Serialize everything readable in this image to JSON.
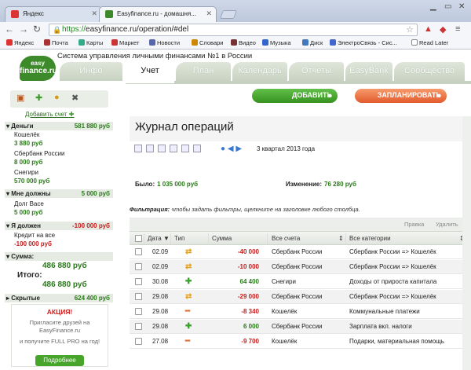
{
  "browser": {
    "tabs": [
      {
        "title": "Яндекс",
        "favicon_color": "#d33"
      },
      {
        "title": "Easyfinance.ru - домашня...",
        "favicon_color": "#3d8a2a"
      }
    ],
    "url_https": "https://",
    "url_rest": "easyfinance.ru/operation/#del",
    "bookmarks": [
      "Яндекс",
      "Почта",
      "Карты",
      "Маркет",
      "Новости",
      "Словари",
      "Видео",
      "Музыка",
      "Диск",
      "ЭлектроСвязь - Сис...",
      "Read Later"
    ],
    "bookmark_colors": [
      "#d33",
      "#a33",
      "#3a8",
      "#c33",
      "#56a",
      "#c80",
      "#733",
      "#36c",
      "#47b",
      "#46c",
      "#fff"
    ]
  },
  "site": {
    "logo_top": "easy",
    "logo_bottom": "finance.ru",
    "slogan": "Система управления личными финансами №1 в России",
    "nav_tabs": [
      "Инфо",
      "Учет",
      "План",
      "Календарь",
      "Отчеты",
      "EasyBank",
      "Сообщество"
    ]
  },
  "sidebar": {
    "add_account": "Добавить счет",
    "sections": [
      {
        "title": "Деньги",
        "amount": "581 880 руб",
        "negative": false,
        "items": [
          {
            "name": "Кошелёк",
            "value": "3 880 руб"
          },
          {
            "name": "Сбербанк России",
            "value": "8 000 руб"
          },
          {
            "name": "Снегири",
            "value": "570 000 руб"
          }
        ]
      },
      {
        "title": "Мне должны",
        "amount": "5 000 руб",
        "negative": false,
        "items": [
          {
            "name": "Долг Васе",
            "value": "5 000 руб"
          }
        ]
      },
      {
        "title": "Я должен",
        "amount": "-100 000 руб",
        "negative": true,
        "items": [
          {
            "name": "Кредит на все",
            "value": "-100 000 руб"
          }
        ]
      }
    ],
    "sum_title": "Сумма:",
    "sum_value": "486 880 руб",
    "total_label": "Итого:",
    "total_value": "486 880 руб",
    "hidden_title": "Скрытые",
    "hidden_amount": "624 400 руб",
    "promo_title": "АКЦИЯ!",
    "promo_text_1": "Пригласите друзей на EasyFinance.ru",
    "promo_text_2": "и получите FULL PRO на год!",
    "promo_button": "Подробнее"
  },
  "main": {
    "add_button": "ДОБАВИТЬ",
    "plan_button": "ЗАПЛАНИРОВАТЬ",
    "page_title": "Журнал операций",
    "period": "3 квартал 2013 года",
    "was_label": "Было:",
    "was_value": "1 035 000 руб",
    "change_label": "Изменение:",
    "change_value": "76 280 руб",
    "filter_label": "Фильтрация:",
    "filter_text": "чтобы задать фильтры, щелкните на заголовке любого столбца.",
    "grid_links": [
      "Правка",
      "Удалить"
    ],
    "columns": [
      "Дата",
      "Тип",
      "Сумма",
      "Все счета",
      "Все категории"
    ],
    "rows": [
      {
        "date": "02.09",
        "type": "transfer",
        "amount": "-40 000",
        "account": "Сбербанк России",
        "category": "Сбербанк России => Кошелёк"
      },
      {
        "date": "02.09",
        "type": "transfer",
        "amount": "-10 000",
        "account": "Сбербанк России",
        "category": "Сбербанк России => Кошелёк"
      },
      {
        "date": "30.08",
        "type": "income",
        "amount": "64 400",
        "account": "Снегири",
        "category": "Доходы от прироста капитала"
      },
      {
        "date": "29.08",
        "type": "transfer",
        "amount": "-29 000",
        "account": "Сбербанк России",
        "category": "Сбербанк России => Кошелёк"
      },
      {
        "date": "29.08",
        "type": "expense",
        "amount": "-8 340",
        "account": "Кошелёк",
        "category": "Коммунальные платежи"
      },
      {
        "date": "29.08",
        "type": "income",
        "amount": "6 000",
        "account": "Сбербанк России",
        "category": "Зарплата вкл. налоги"
      },
      {
        "date": "27.08",
        "type": "expense",
        "amount": "-9 700",
        "account": "Кошелёк",
        "category": "Подарки, материальная помощь"
      }
    ],
    "type_icons": {
      "transfer": "⇄",
      "income": "✚",
      "expense": "━"
    }
  }
}
